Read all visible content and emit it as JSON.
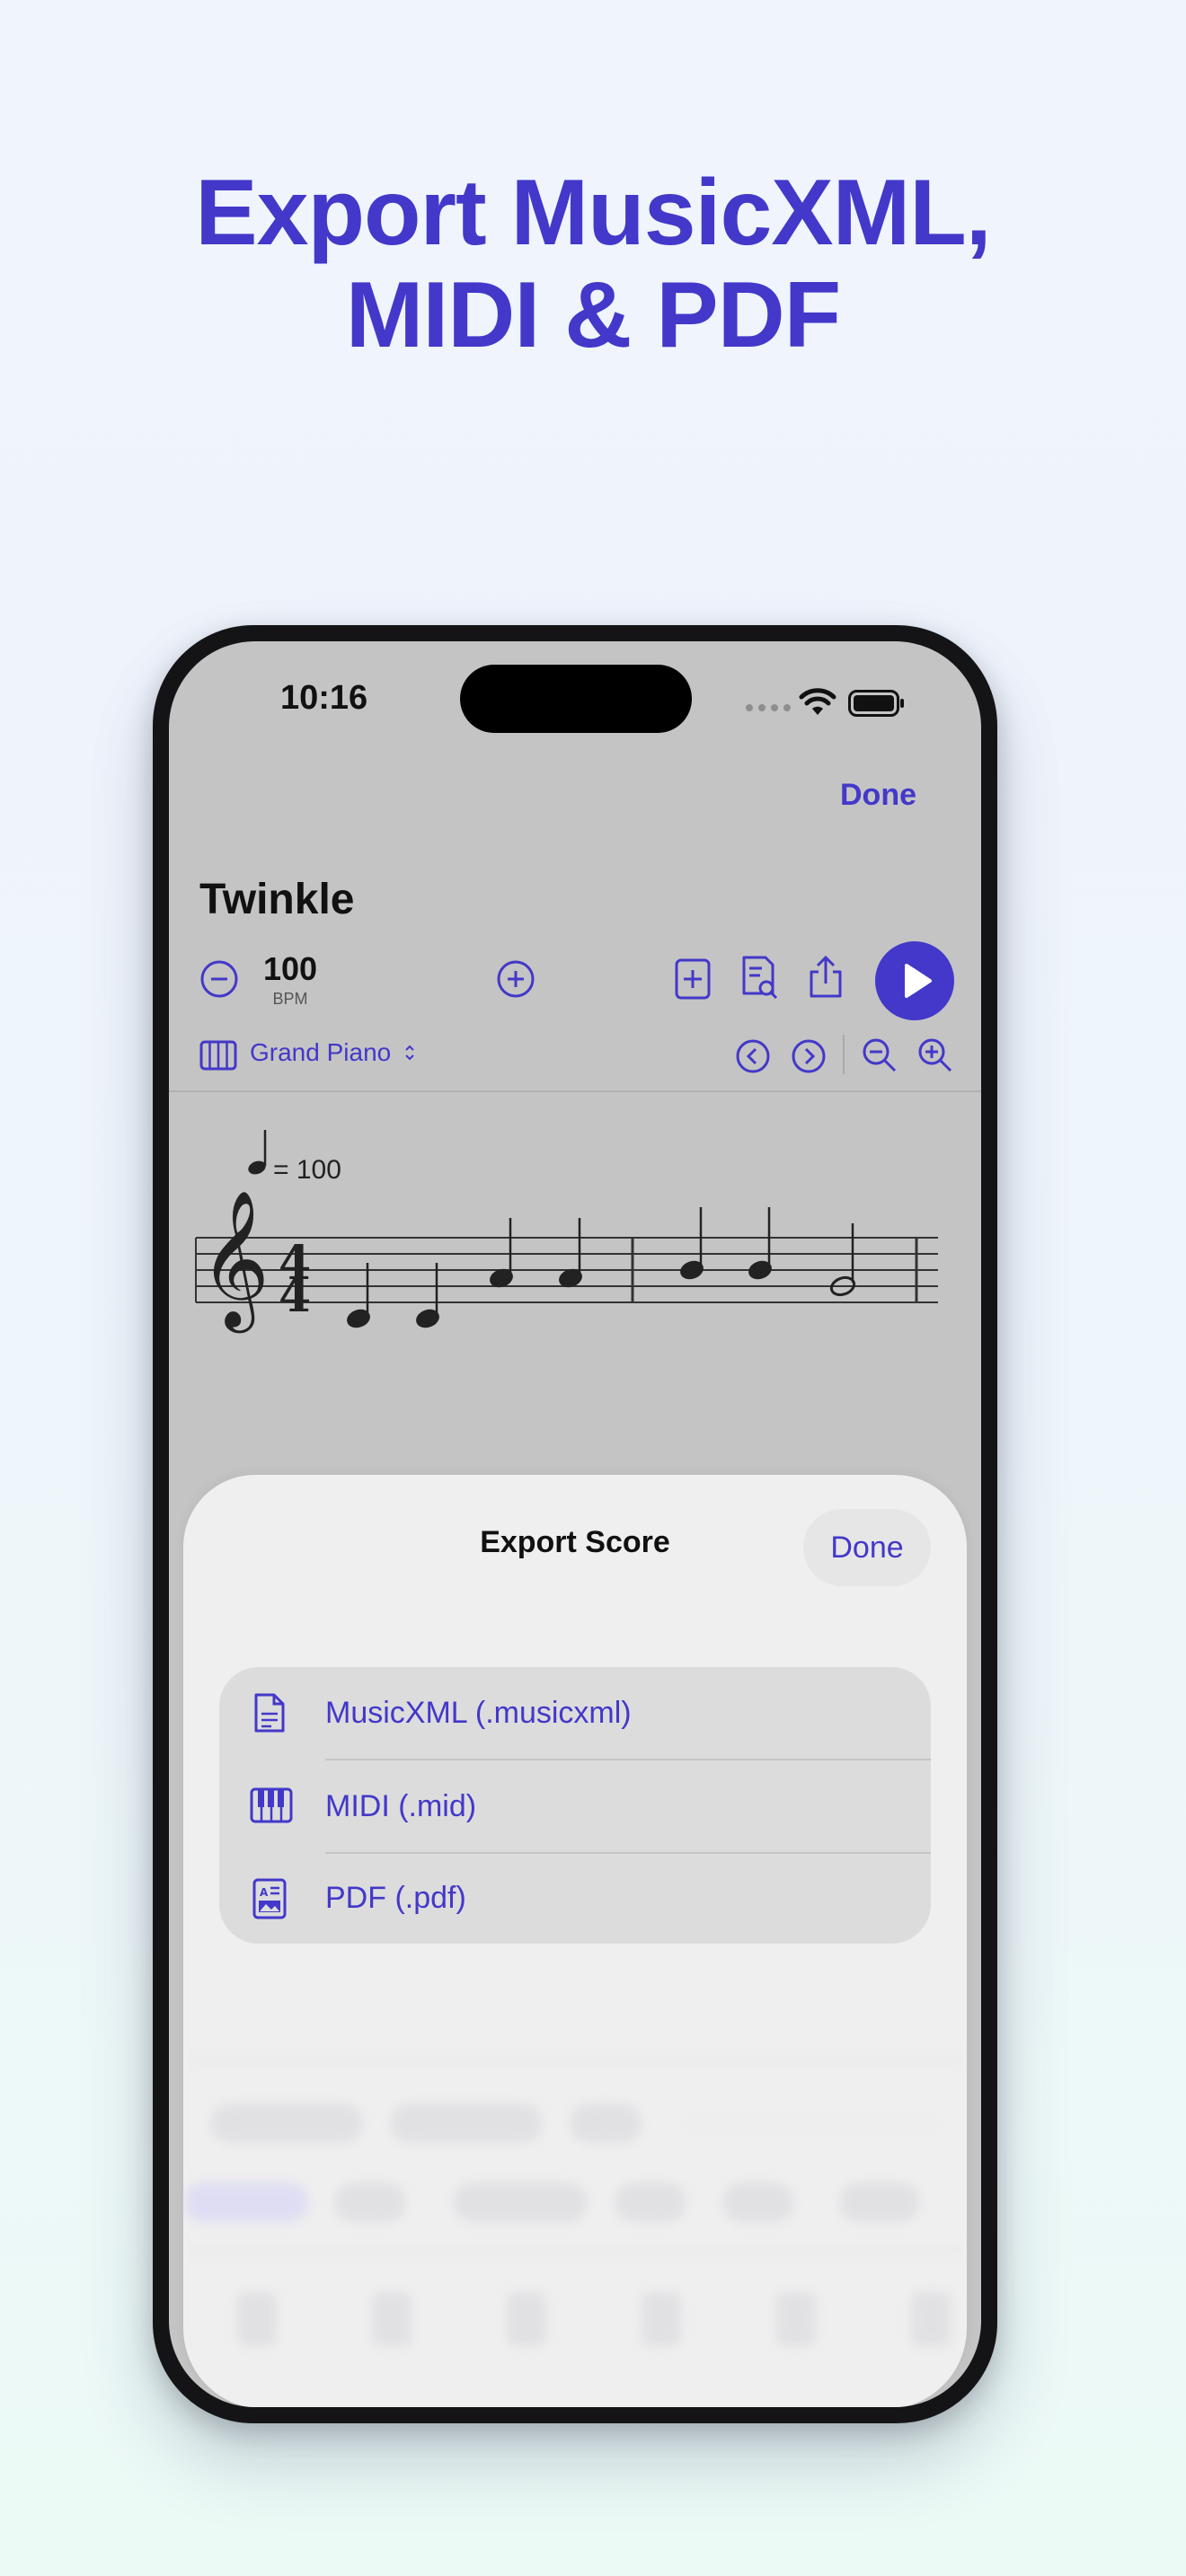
{
  "headline": {
    "line1": "Export MusicXML,",
    "line2": "MIDI & PDF"
  },
  "status_bar": {
    "time": "10:16"
  },
  "nav": {
    "done_label": "Done"
  },
  "score": {
    "title": "Twinkle",
    "tempo_value": "100",
    "tempo_unit": "BPM",
    "tempo_marking": "= 100",
    "instrument": "Grand Piano"
  },
  "export_sheet": {
    "title": "Export Score",
    "done_label": "Done",
    "options": [
      {
        "label": "MusicXML (.musicxml)",
        "icon": "document-icon"
      },
      {
        "label": "MIDI (.mid)",
        "icon": "piano-keys-icon"
      },
      {
        "label": "PDF (.pdf)",
        "icon": "pdf-image-icon"
      }
    ]
  },
  "colors": {
    "accent": "#4338c9",
    "screen_bg": "#c4c4c4",
    "sheet_bg": "#efefef"
  }
}
